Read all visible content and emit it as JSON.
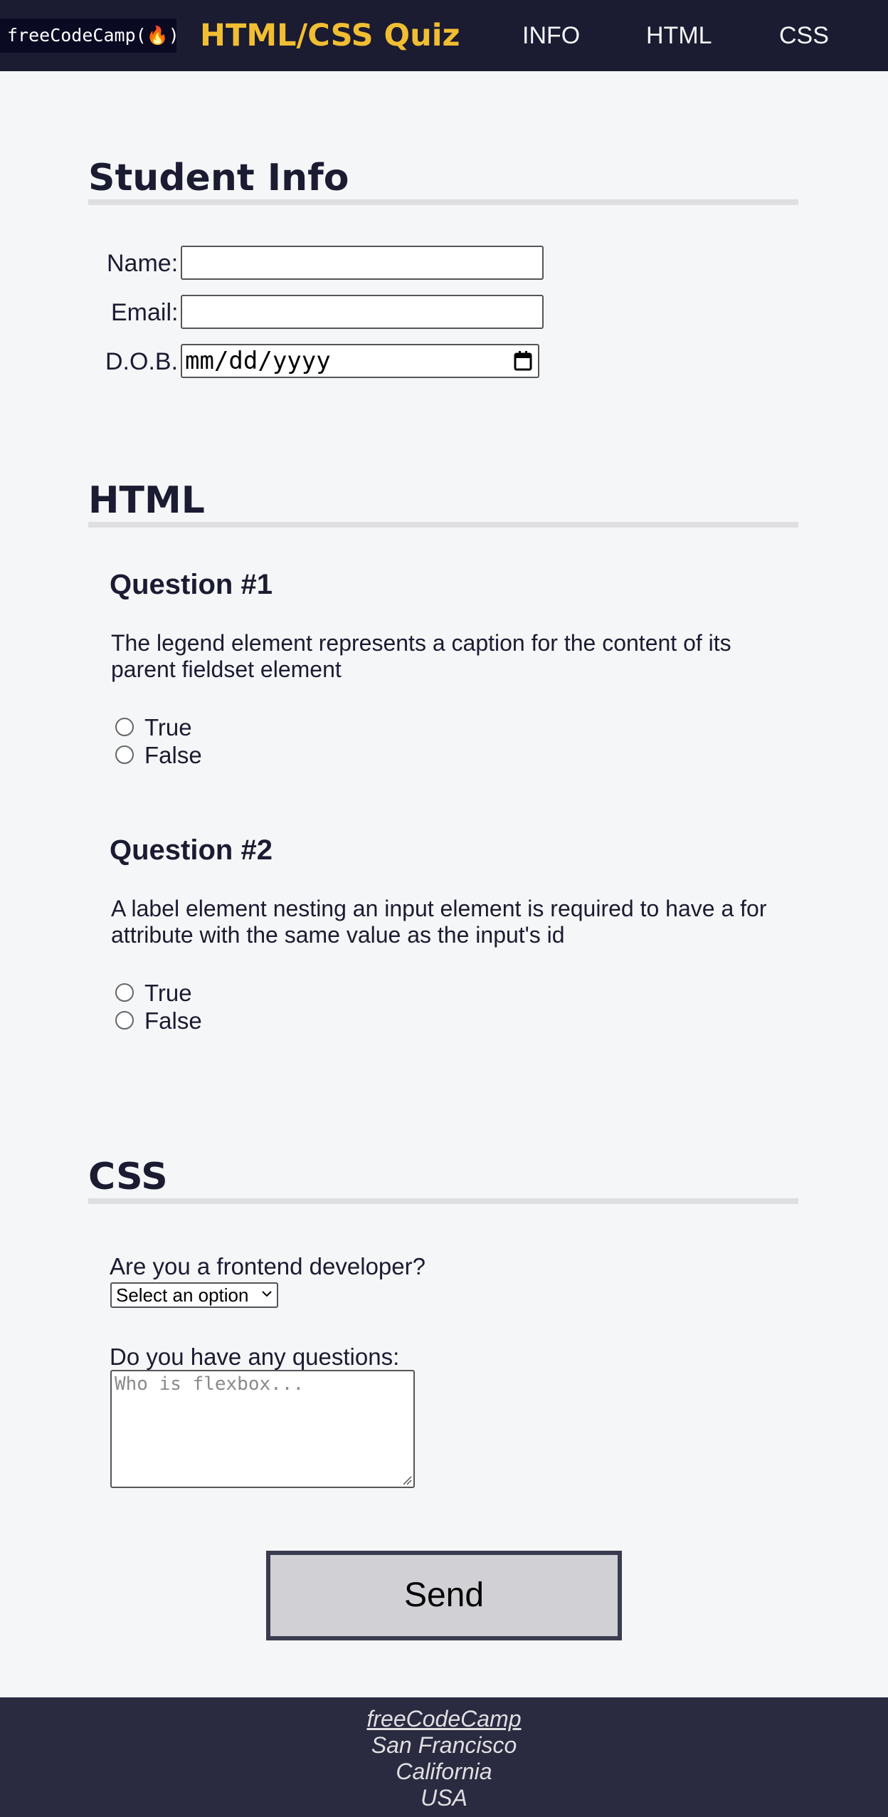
{
  "nav": {
    "logo": "freeCodeCamp(🔥)",
    "title": "HTML/CSS Quiz",
    "links": [
      "INFO",
      "HTML",
      "CSS"
    ]
  },
  "info": {
    "heading": "Student Info",
    "name_label": "Name:",
    "email_label": "Email:",
    "dob_label": "D.O.B.",
    "dob_placeholder": "mm/dd/yyyy"
  },
  "html": {
    "heading": "HTML",
    "questions": [
      {
        "title": "Question #1",
        "text": "The legend element represents a caption for the content of its parent fieldset element",
        "options": [
          "True",
          "False"
        ]
      },
      {
        "title": "Question #2",
        "text": "A label element nesting an input element is required to have a for attribute with the same value as the input's id",
        "options": [
          "True",
          "False"
        ]
      }
    ]
  },
  "css": {
    "heading": "CSS",
    "frontend_question": "Are you a frontend developer?",
    "select_value": "Select an option",
    "questions_label": "Do you have any questions:",
    "textarea_placeholder": "Who is flexbox..."
  },
  "send_label": "Send",
  "footer": {
    "link": "freeCodeCamp",
    "lines": [
      "San Francisco",
      "California",
      "USA"
    ]
  },
  "colors": {
    "nav_bg": "#1b1b32",
    "title": "#f1be32",
    "page_bg": "#f5f6f7",
    "footer_bg": "#2a2a40",
    "button_bg": "#d0d0d5"
  }
}
